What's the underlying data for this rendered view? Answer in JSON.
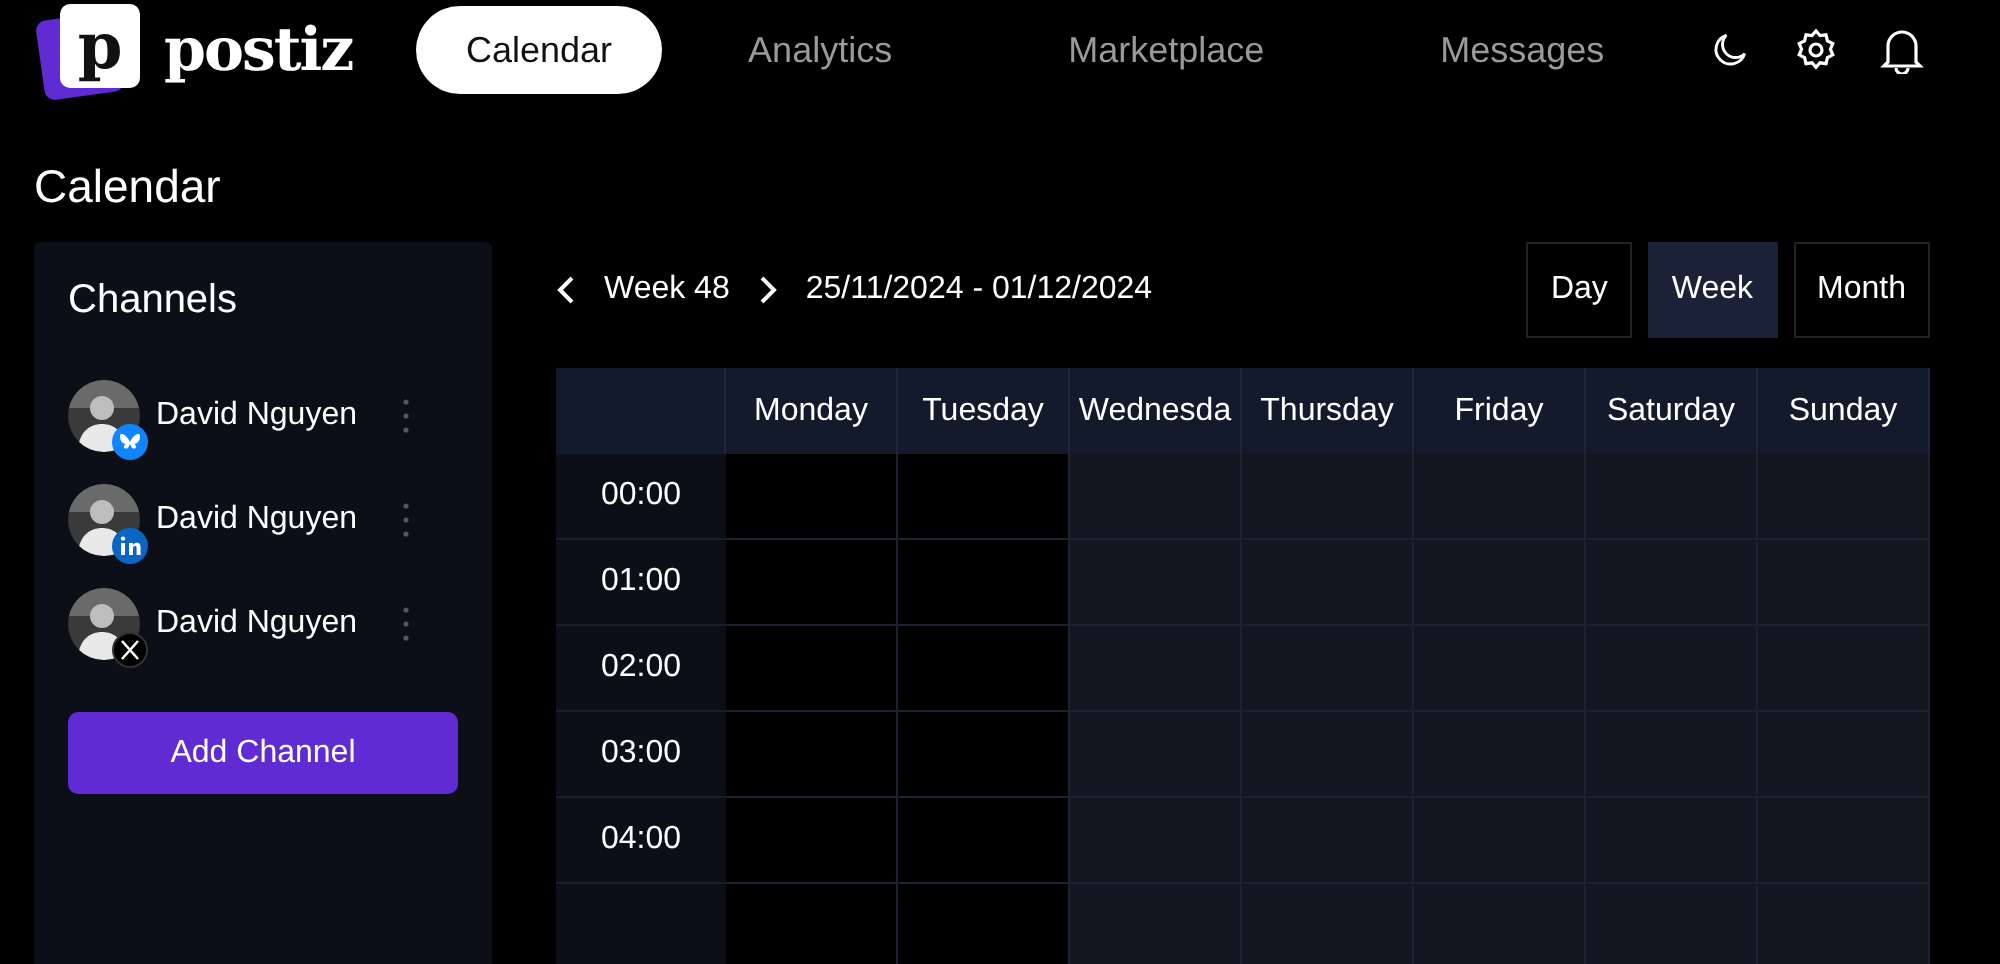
{
  "logo": {
    "mark": "p",
    "name": "postiz"
  },
  "nav": [
    {
      "label": "Calendar",
      "selected": true
    },
    {
      "label": "Analytics",
      "selected": false
    },
    {
      "label": "Marketplace",
      "selected": false
    },
    {
      "label": "Messages",
      "selected": false
    }
  ],
  "page_title": "Calendar",
  "channels": {
    "title": "Channels",
    "items": [
      {
        "name": "David Nguyen",
        "kind": "bluesky"
      },
      {
        "name": "David Nguyen",
        "kind": "linkedin"
      },
      {
        "name": "David Nguyen",
        "kind": "x"
      }
    ],
    "add_button": "Add Channel"
  },
  "week_nav": {
    "week": "Week 48",
    "range": "25/11/2024 - 01/12/2024"
  },
  "views": [
    {
      "label": "Day",
      "selected": false
    },
    {
      "label": "Week",
      "selected": true
    },
    {
      "label": "Month",
      "selected": false
    }
  ],
  "days": [
    {
      "label": "Monday",
      "past": true
    },
    {
      "label": "Tuesday",
      "past": true
    },
    {
      "label": "Wednesda",
      "past": false
    },
    {
      "label": "Thursday",
      "past": false
    },
    {
      "label": "Friday",
      "past": false
    },
    {
      "label": "Saturday",
      "past": false
    },
    {
      "label": "Sunday",
      "past": false
    }
  ],
  "hours": [
    "00:00",
    "01:00",
    "02:00",
    "03:00",
    "04:00"
  ]
}
